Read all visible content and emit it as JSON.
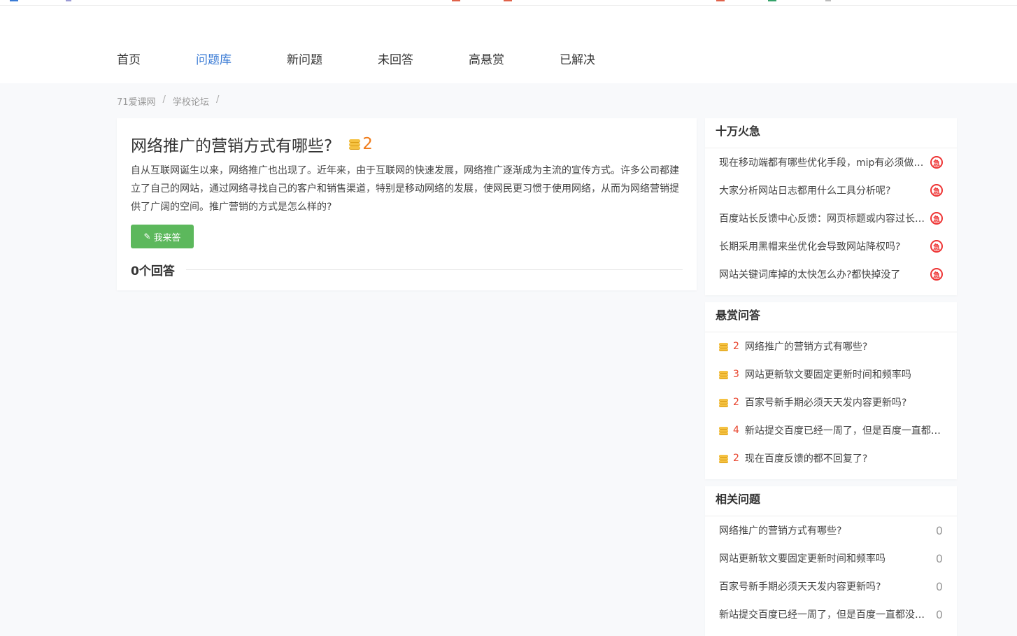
{
  "nav": {
    "items": [
      {
        "label": "首页",
        "active": false
      },
      {
        "label": "问题库",
        "active": true
      },
      {
        "label": "新问题",
        "active": false
      },
      {
        "label": "未回答",
        "active": false
      },
      {
        "label": "高悬赏",
        "active": false
      },
      {
        "label": "已解决",
        "active": false
      }
    ]
  },
  "breadcrumb": {
    "items": [
      "71爱课网",
      "学校论坛"
    ],
    "separator": "/"
  },
  "question": {
    "title": "网络推广的营销方式有哪些?",
    "reward": "2",
    "description": "自从互联网诞生以来，网络推广也出现了。近年来，由于互联网的快速发展，网络推广逐渐成为主流的宣传方式。许多公司都建立了自己的网站，通过网络寻找自己的客户和销售渠道，特别是移动网络的发展，使网民更习惯于使用网络，从而为网络营销提供了广阔的空间。推广营销的方式是怎么样的?",
    "answer_button": "我来答",
    "answers_label": "0个回答"
  },
  "urgent": {
    "title": "十万火急",
    "icon_label": "急",
    "items": [
      "现在移动端都有哪些优化手段，mip有必须做吗?",
      "大家分析网站日志都用什么工具分析呢?",
      "百度站长反馈中心反馈：网页标题或内容过长怎么办?",
      "长期采用黑帽来坐优化会导致网站降权吗?",
      "网站关键词库掉的太快怎么办?都快掉没了"
    ]
  },
  "reward": {
    "title": "悬赏问答",
    "items": [
      {
        "reward": "2",
        "text": "网络推广的营销方式有哪些?"
      },
      {
        "reward": "3",
        "text": "网站更新软文要固定更新时间和频率吗"
      },
      {
        "reward": "2",
        "text": "百家号新手期必须天天发内容更新吗?"
      },
      {
        "reward": "4",
        "text": "新站提交百度已经一周了，但是百度一直都没有收录"
      },
      {
        "reward": "2",
        "text": "现在百度反馈的都不回复了?"
      }
    ]
  },
  "related": {
    "title": "相关问题",
    "items": [
      {
        "text": "网络推广的营销方式有哪些?",
        "count": "0"
      },
      {
        "text": "网站更新软文要固定更新时间和频率吗",
        "count": "0"
      },
      {
        "text": "百家号新手期必须天天发内容更新吗?",
        "count": "0"
      },
      {
        "text": "新站提交百度已经一周了，但是百度一直都没有收录",
        "count": "0"
      }
    ]
  },
  "colors": {
    "accent": "#3a7bd5",
    "reward": "#f07c1b",
    "button": "#5cb85c",
    "urgent": "#ee3333"
  }
}
